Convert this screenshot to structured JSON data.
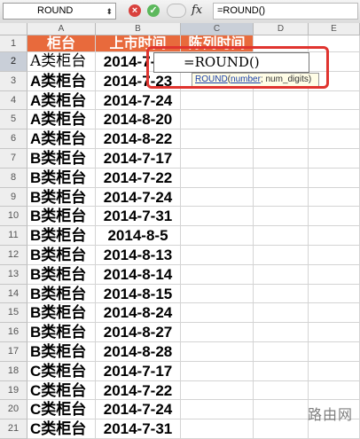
{
  "formula_bar": {
    "name_box": "ROUND",
    "cancel_icon": "×",
    "accept_icon": "✓",
    "fx_label": "fx",
    "formula": "=ROUND()"
  },
  "columns": [
    "A",
    "B",
    "C",
    "D",
    "E"
  ],
  "header_row": {
    "row_num": "1",
    "a": "柜台",
    "b": "上市时间",
    "c": "陈列时间"
  },
  "rows": [
    {
      "n": "2",
      "a": "A类柜台",
      "b": "2014-7-22"
    },
    {
      "n": "3",
      "a": "A类柜台",
      "b": "2014-7-23"
    },
    {
      "n": "4",
      "a": "A类柜台",
      "b": "2014-7-24"
    },
    {
      "n": "5",
      "a": "A类柜台",
      "b": "2014-8-20"
    },
    {
      "n": "6",
      "a": "A类柜台",
      "b": "2014-8-22"
    },
    {
      "n": "7",
      "a": "B类柜台",
      "b": "2014-7-17"
    },
    {
      "n": "8",
      "a": "B类柜台",
      "b": "2014-7-22"
    },
    {
      "n": "9",
      "a": "B类柜台",
      "b": "2014-7-24"
    },
    {
      "n": "10",
      "a": "B类柜台",
      "b": "2014-7-31"
    },
    {
      "n": "11",
      "a": "B类柜台",
      "b": "2014-8-5"
    },
    {
      "n": "12",
      "a": "B类柜台",
      "b": "2014-8-13"
    },
    {
      "n": "13",
      "a": "B类柜台",
      "b": "2014-8-14"
    },
    {
      "n": "14",
      "a": "B类柜台",
      "b": "2014-8-15"
    },
    {
      "n": "15",
      "a": "B类柜台",
      "b": "2014-8-24"
    },
    {
      "n": "16",
      "a": "B类柜台",
      "b": "2014-8-27"
    },
    {
      "n": "17",
      "a": "B类柜台",
      "b": "2014-8-28"
    },
    {
      "n": "18",
      "a": "C类柜台",
      "b": "2014-7-17"
    },
    {
      "n": "19",
      "a": "C类柜台",
      "b": "2014-7-22"
    },
    {
      "n": "20",
      "a": "C类柜台",
      "b": "2014-7-24"
    },
    {
      "n": "21",
      "a": "C类柜台",
      "b": "2014-7-31"
    }
  ],
  "editor": {
    "text": "=ROUND()",
    "tooltip_fn": "ROUND",
    "tooltip_arg1": "number",
    "tooltip_arg2": "num_digits"
  },
  "watermark": "路由网",
  "colors": {
    "header_fill": "#e86a3c",
    "highlight_border": "#e0342f",
    "selected_header": "#c9cfd8"
  }
}
